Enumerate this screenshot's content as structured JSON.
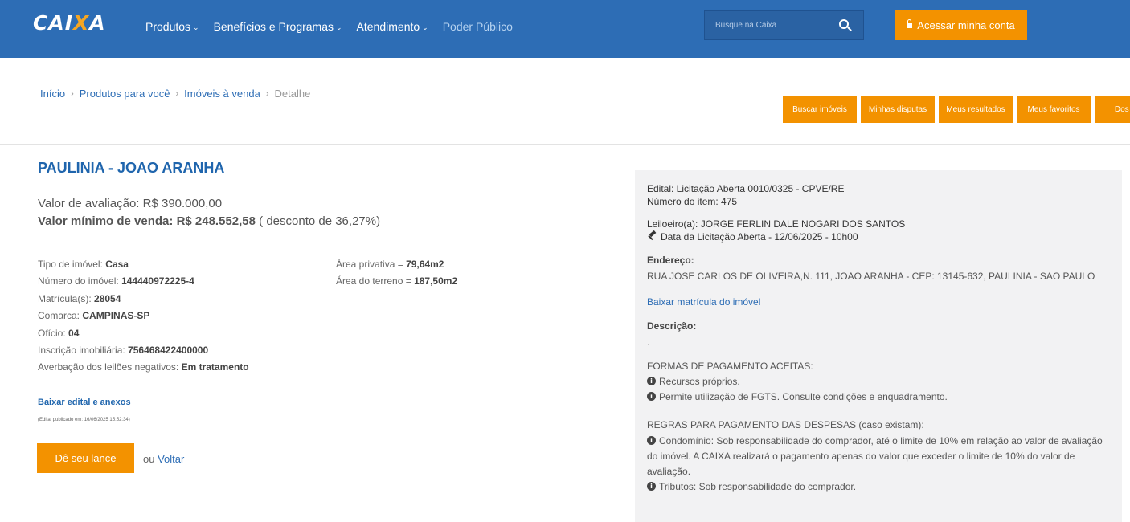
{
  "header": {
    "logo": {
      "text_before": "CAI",
      "text_x": "X",
      "text_after": "A"
    },
    "nav": [
      {
        "label": "Produtos",
        "dropdown": true
      },
      {
        "label": "Benefícios e Programas",
        "dropdown": true
      },
      {
        "label": "Atendimento",
        "dropdown": true
      },
      {
        "label": "Poder Público",
        "dropdown": false
      }
    ],
    "search_placeholder": "Busque na Caixa",
    "login_label": "Acessar minha conta",
    "colors": {
      "header_bg": "#2d6db5",
      "accent": "#f39200"
    }
  },
  "breadcrumb": {
    "items": [
      "Início",
      "Produtos para você",
      "Imóveis à venda"
    ],
    "current": "Detalhe"
  },
  "actions": [
    {
      "label": "Buscar imóveis"
    },
    {
      "label": "Minhas disputas"
    },
    {
      "label": "Meus resultados"
    },
    {
      "label": "Meus favoritos"
    },
    {
      "label": "Dos cada"
    }
  ],
  "property": {
    "title": "PAULINIA - JOAO ARANHA",
    "valuation_label": "Valor de avaliação:",
    "valuation_value": "R$ 390.000,00",
    "minimum_label": "Valor mínimo de venda:",
    "minimum_value": "R$ 248.552,58",
    "discount_text": "( desconto de 36,27%)",
    "details": [
      {
        "label": "Tipo de imóvel:",
        "value": "Casa"
      },
      {
        "label": "Número do imóvel:",
        "value": "144440972225-4"
      },
      {
        "label": "Matrícula(s):",
        "value": "28054"
      },
      {
        "label": "Comarca:",
        "value": "CAMPINAS-SP"
      },
      {
        "label": "Ofício:",
        "value": "04"
      },
      {
        "label": "Inscrição imobiliária:",
        "value": "756468422400000"
      },
      {
        "label": "Averbação dos leilões negativos:",
        "value": "Em tratamento"
      }
    ],
    "areas": [
      {
        "label": "Área privativa =",
        "value": "79,64m2"
      },
      {
        "label": "Área do terreno =",
        "value": "187,50m2"
      }
    ],
    "edital_link": "Baixar edital e anexos",
    "edital_date": "(Edital publicado em: 16/06/2025 15:52:34)",
    "bid_label": "Dê seu lance",
    "back_prefix": "ou",
    "back_label": "Voltar"
  },
  "panel": {
    "edital": "Edital: Licitação Aberta 0010/0325 - CPVE/RE",
    "item_number": "Número do item: 475",
    "leiloeiro": "Leiloeiro(a): JORGE FERLIN DALE NOGARI DOS SANTOS",
    "date": "Data da Licitação Aberta - 12/06/2025 - 10h00",
    "address_label": "Endereço:",
    "address": "RUA JOSE CARLOS DE OLIVEIRA,N. 111, JOAO ARANHA - CEP: 13145-632, PAULINIA - SAO PAULO",
    "matricula_link": "Baixar matrícula do imóvel",
    "description_label": "Descrição:",
    "description": ".",
    "payment_title": "FORMAS DE PAGAMENTO ACEITAS:",
    "payment_items": [
      "Recursos próprios.",
      "Permite utilização de FGTS. Consulte condições e enquadramento."
    ],
    "rules_title": "REGRAS PARA PAGAMENTO DAS DESPESAS (caso existam):",
    "rules_items": [
      "Condomínio: Sob responsabilidade do comprador, até o limite de 10% em relação ao valor de avaliação do imóvel. A CAIXA realizará o pagamento apenas do valor que exceder o limite de 10% do valor de avaliação.",
      "Tributos: Sob responsabilidade do comprador."
    ]
  }
}
